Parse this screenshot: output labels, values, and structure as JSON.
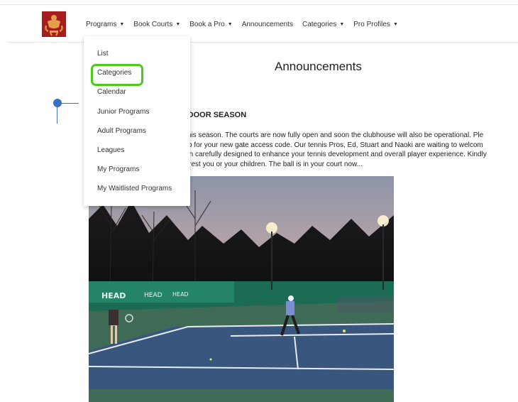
{
  "nav": {
    "items": [
      {
        "label": "Programs",
        "has_caret": true
      },
      {
        "label": "Book Courts",
        "has_caret": true
      },
      {
        "label": "Book a Pro",
        "has_caret": true
      },
      {
        "label": "Announcements",
        "has_caret": false
      },
      {
        "label": "Categories",
        "has_caret": true
      },
      {
        "label": "Pro Profiles",
        "has_caret": true
      }
    ]
  },
  "dropdown": {
    "highlighted_item": "Categories",
    "highlight_color": "#4ccc18",
    "items": [
      "List",
      "Categories",
      "Calendar",
      "Junior Programs",
      "Adult Programs",
      "Leagues",
      "My Programs",
      "My Waitlisted Programs"
    ]
  },
  "page": {
    "title": "Announcements"
  },
  "post": {
    "heading": "UTDOOR SEASON",
    "lines": [
      "tennis season. The courts are now fully open and soon the clubhouse will also be operational. Ple",
      "Club for your new gate access code. Our tennis Pros, Ed, Stuart and Naoki are waiting to welcom",
      "been carefully designed to enhance your tennis development and overall player experience. Kindly",
      "interest you or your children. The ball is in your court now..."
    ],
    "image_icon": "tennis-court-photo"
  },
  "colors": {
    "accent": "#3a6fc2",
    "logo": "#a51d1d"
  }
}
